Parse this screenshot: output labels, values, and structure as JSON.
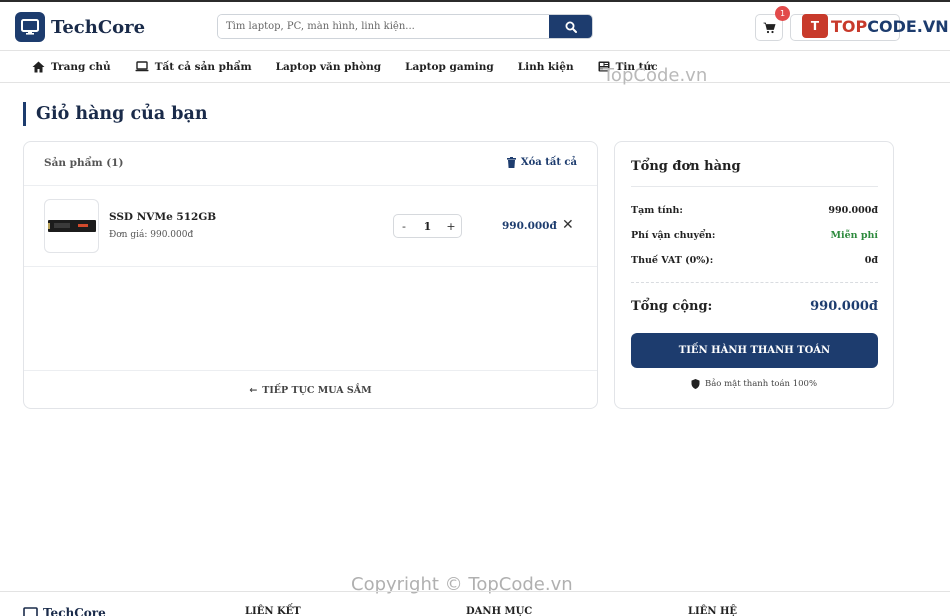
{
  "brand": {
    "name": "TechCore"
  },
  "search": {
    "placeholder": "Tìm laptop, PC, màn hình, linh kiện..."
  },
  "header": {
    "cart_badge": "1"
  },
  "watermark": {
    "logo_text_main": "TOP",
    "logo_text_rest": "CODE.VN",
    "logo_icon": "T",
    "text_top": "TopCode.vn",
    "text_bottom": "Copyright © TopCode.vn"
  },
  "nav": {
    "items": [
      {
        "label": "Trang chủ",
        "icon": "home-icon"
      },
      {
        "label": "Tất cả sản phẩm",
        "icon": "laptop-icon"
      },
      {
        "label": "Laptop văn phòng"
      },
      {
        "label": "Laptop gaming"
      },
      {
        "label": "Linh kiện"
      },
      {
        "label": "Tin tức",
        "icon": "newspaper-icon"
      }
    ]
  },
  "page": {
    "title": "Giỏ hàng của bạn"
  },
  "cart": {
    "count_label": "Sản phẩm (1)",
    "clear_all": "Xóa tất cả",
    "items": [
      {
        "name": "SSD NVMe 512GB",
        "unit_price": "Đơn giá: 990.000đ",
        "qty": "1",
        "minus": "-",
        "plus": "+",
        "total": "990.000đ",
        "remove": "✕"
      }
    ],
    "continue_label": "TIẾP TỤC MUA SẮM"
  },
  "summary": {
    "title": "Tổng đơn hàng",
    "subtotal_label": "Tạm tính:",
    "subtotal_value": "990.000đ",
    "shipping_label": "Phí vận chuyển:",
    "shipping_value": "Miễn phí",
    "vat_label": "Thuế VAT (0%):",
    "vat_value": "0đ",
    "total_label": "Tổng cộng:",
    "total_value": "990.000đ",
    "checkout_label": "TIẾN HÀNH THANH TOÁN",
    "secure_label": "Bảo mật thanh toán 100%"
  },
  "footer": {
    "brand": "TechCore",
    "col1": "LIÊN KẾT",
    "col2": "DANH MỤC",
    "col3": "LIÊN HỆ"
  },
  "colors": {
    "primary": "#1d3c6e",
    "free": "#2e8b3e",
    "badge": "#e24b4b"
  }
}
